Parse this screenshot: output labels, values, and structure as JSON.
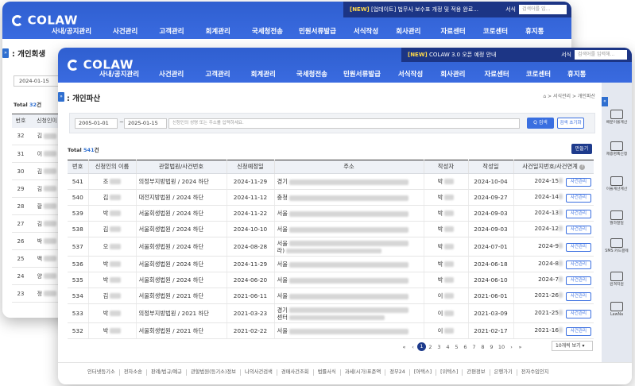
{
  "back": {
    "notice": {
      "tag": "[NEW]",
      "text": " [업데이트] 법무사 보수표 개정 및 적용 완료...",
      "select": "서식",
      "placeholder": "검색어를 입..."
    },
    "logo": "COLAW",
    "menu": [
      "사내/공지관리",
      "사건관리",
      "고객관리",
      "회계관리",
      "국세청전송",
      "민원서류발급",
      "서식작성",
      "회사관리",
      "자료센터",
      "코로센터",
      "휴지통"
    ],
    "page_title": ": 개인회생",
    "date": "2024-01-15",
    "total_label": "Total ",
    "total_value": "32",
    "total_unit": "건",
    "columns": [
      "번호",
      "신청인이"
    ],
    "rows": [
      {
        "no": "32",
        "name": "김"
      },
      {
        "no": "31",
        "name": "이"
      },
      {
        "no": "30",
        "name": "김"
      },
      {
        "no": "29",
        "name": "김"
      },
      {
        "no": "28",
        "name": "황"
      },
      {
        "no": "27",
        "name": "김"
      },
      {
        "no": "26",
        "name": "박"
      },
      {
        "no": "25",
        "name": "백"
      },
      {
        "no": "24",
        "name": "양"
      },
      {
        "no": "23",
        "name": "정"
      }
    ]
  },
  "front": {
    "notice": {
      "tag": "[NEW]",
      "text": " COLAW 3.0 오픈 예정 안내",
      "select": "서식",
      "placeholder": "검색어를 입력해..."
    },
    "logo": "COLAW",
    "menu": [
      "사내/공지관리",
      "사건관리",
      "고객관리",
      "회계관리",
      "국세청전송",
      "민원서류발급",
      "서식작성",
      "회사관리",
      "자료센터",
      "코로센터",
      "휴지통"
    ],
    "page_title": ": 개인파산",
    "breadcrumb": "⌂ > 서식관리 > 개인파산",
    "search": {
      "date_from": "2005-01-01",
      "tilde": "~",
      "date_to": "2025-01-15",
      "placeholder": "신청인의 성명 또는 주소를 입력하세요.",
      "search_label": "Q 검색",
      "reset_label": "검색 초기화"
    },
    "total_label": "Total ",
    "total_value": "541",
    "total_unit": "건",
    "new_button": "만들기",
    "columns": [
      "번호",
      "신청인의 이름",
      "관할법원/사건번호",
      "신청예정일",
      "주소",
      "작성자",
      "작성일",
      "사건일지번호/사건연계"
    ],
    "manage_label": "사건관리",
    "rows": [
      {
        "no": "541",
        "name": "조",
        "court": "의정부지방법원 / 2024 하단",
        "planned": "2024-11-29",
        "addr": "경기",
        "writer": "박",
        "written": "2024-10-04",
        "case": "2024-15"
      },
      {
        "no": "540",
        "name": "김",
        "court": "대전지방법원 / 2024 하단",
        "planned": "2024-11-12",
        "addr": "충청",
        "writer": "박",
        "written": "2024-09-27",
        "case": "2024-14"
      },
      {
        "no": "539",
        "name": "박",
        "court": "서울회생법원 / 2024 하단",
        "planned": "2024-11-22",
        "addr": "서울",
        "writer": "박",
        "written": "2024-09-03",
        "case": "2024-13"
      },
      {
        "no": "538",
        "name": "김",
        "court": "서울회생법원 / 2024 하단",
        "planned": "2024-10-10",
        "addr": "서울",
        "writer": "박",
        "written": "2024-09-03",
        "case": "2024-12"
      },
      {
        "no": "537",
        "name": "오",
        "court": "서울회생법원 / 2024 하단",
        "planned": "2024-08-28",
        "addr": "서울",
        "addr2": "라)",
        "writer": "박",
        "written": "2024-07-01",
        "case": "2024-9"
      },
      {
        "no": "536",
        "name": "박",
        "court": "서울회생법원 / 2024 하단",
        "planned": "2024-11-29",
        "addr": "서울",
        "writer": "박",
        "written": "2024-06-18",
        "case": "2024-8"
      },
      {
        "no": "535",
        "name": "박",
        "court": "서울회생법원 / 2024 하단",
        "planned": "2024-06-20",
        "addr": "서울",
        "writer": "박",
        "written": "2024-06-10",
        "case": "2024-7"
      },
      {
        "no": "534",
        "name": "김",
        "court": "서울회생법원 / 2021 하단",
        "planned": "2021-06-11",
        "addr": "서울",
        "writer": "이",
        "written": "2021-06-01",
        "case": "2021-26"
      },
      {
        "no": "533",
        "name": "박",
        "court": "의정부지방법원 / 2021 하단",
        "planned": "2021-03-23",
        "addr": "경기",
        "addr2": "센터",
        "writer": "이",
        "written": "2021-03-09",
        "case": "2021-25"
      },
      {
        "no": "532",
        "name": "박",
        "court": "서울회생법원 / 2021 하단",
        "planned": "2021-02-22",
        "addr": "서울",
        "writer": "이",
        "written": "2021-02-17",
        "case": "2021-16"
      }
    ],
    "pager": {
      "first": "«",
      "prev": "‹",
      "pages": [
        "1",
        "2",
        "3",
        "4",
        "5",
        "6",
        "7",
        "8",
        "9",
        "10"
      ],
      "current": "1",
      "next": "›",
      "last": "»",
      "size_select": "10개씩 보기 ▾"
    },
    "footer_links": [
      "인터넷등기소",
      "전자소송",
      "판례/법규/예규",
      "관할법원(등기소)정보",
      "나의사건검색",
      "경매사건조회",
      "법률서식",
      "과세(시가)표준액",
      "정부24",
      "[아텍스]",
      "[위텍스]",
      "간편정보",
      "은행가기",
      "전자수입인지"
    ],
    "right_side": [
      "배분이율계산",
      "제증명폭신청",
      "이율계산계산",
      "월하말일",
      "SMS 카드결제",
      "원격지원",
      "LawNa"
    ]
  }
}
